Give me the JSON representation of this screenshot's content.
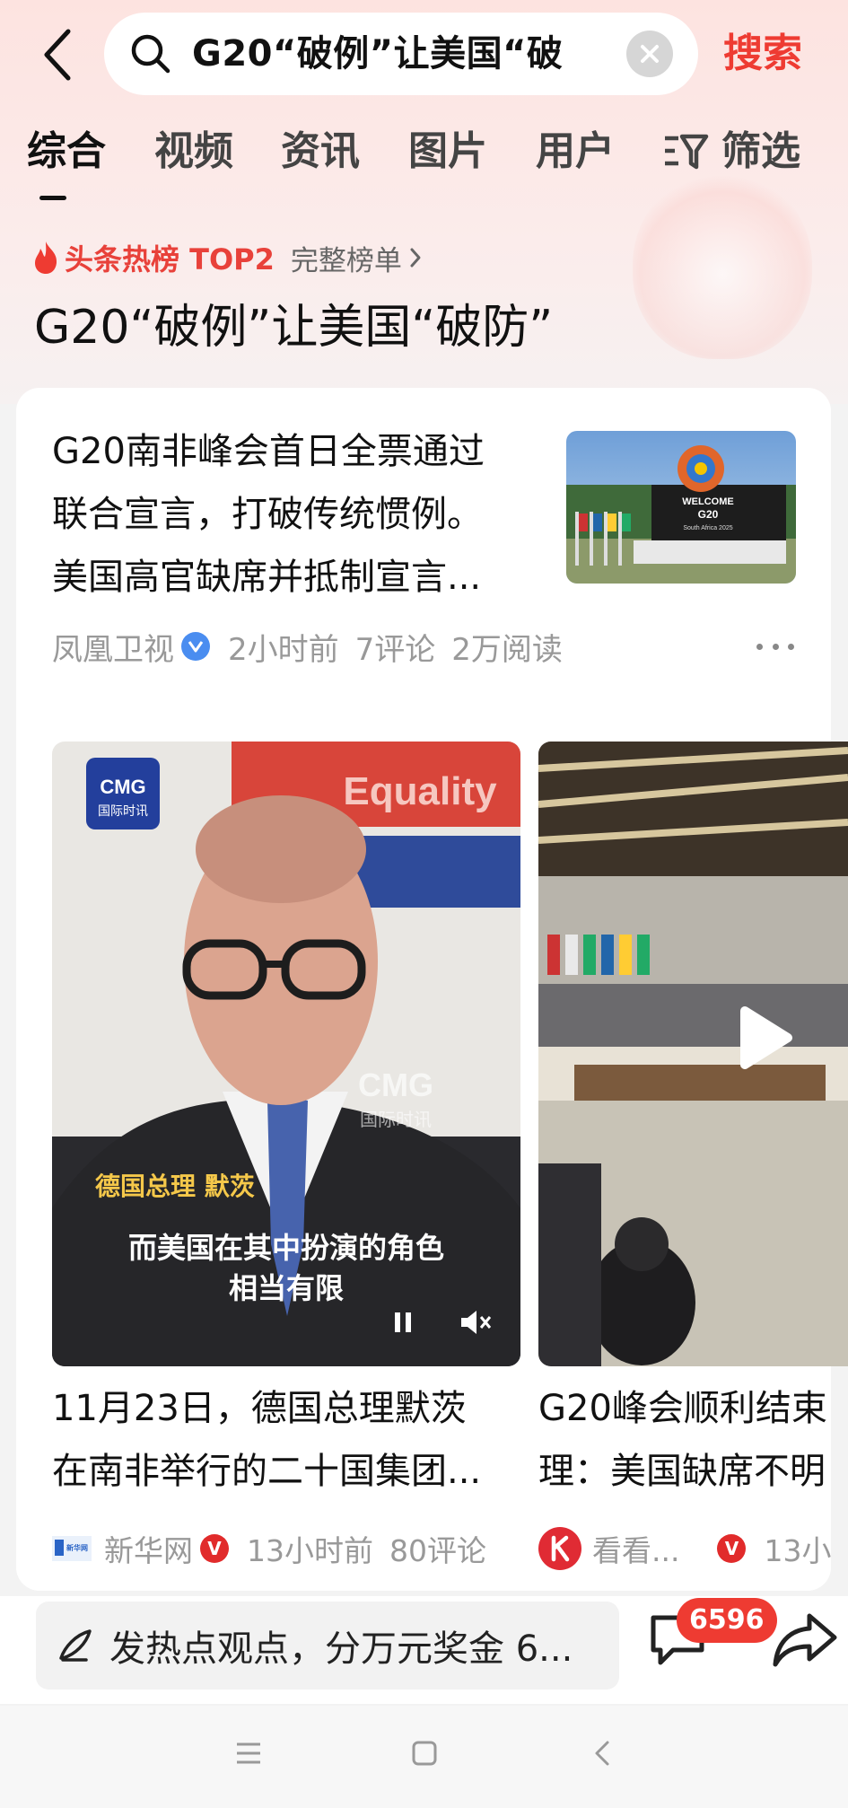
{
  "search": {
    "query": "G20“破例”让美国“破",
    "button": "搜索"
  },
  "tabs": [
    "综合",
    "视频",
    "资讯",
    "图片",
    "用户",
    "筛选"
  ],
  "hot": {
    "tag": "头条热榜 TOP2",
    "more": "完整榜单"
  },
  "headline": "G20“破例”让美国“破防”",
  "article": {
    "lines": [
      "G20南非峰会首日全票通过",
      "联合宣言，打破传统惯例。",
      "美国高官缺席并抵制宣言..."
    ],
    "source": "凤凰卫视",
    "time": "2小时前",
    "comments": "7评论",
    "reads": "2万阅读",
    "thumb_sign": [
      "WELCOME",
      "G20",
      "South Africa 2025"
    ]
  },
  "video1": {
    "logo": [
      "CMG",
      "国际时讯"
    ],
    "watermark": [
      "CMG",
      "国际时讯"
    ],
    "banner": "Equality",
    "name_tag": "德国总理 默茨",
    "subtitle": [
      "而美国在其中扮演的角色",
      "相当有限"
    ],
    "caption": [
      "11月23日，德国总理默茨",
      "在南非举行的二十国集团..."
    ],
    "source": "新华网",
    "source_logo": "新华网",
    "time": "13小时前",
    "comments": "80评论"
  },
  "video2": {
    "caption": [
      "G20峰会顺利结束",
      "理：美国缺席不明"
    ],
    "source": "看看...",
    "time": "13小"
  },
  "comment_bar": {
    "placeholder": "发热点观点，分万元奖金 6...",
    "count": "6596"
  },
  "colors": {
    "accent": "#ee3b32",
    "verified_blue": "#4a8df0",
    "verified_red": "#e12b2b"
  }
}
